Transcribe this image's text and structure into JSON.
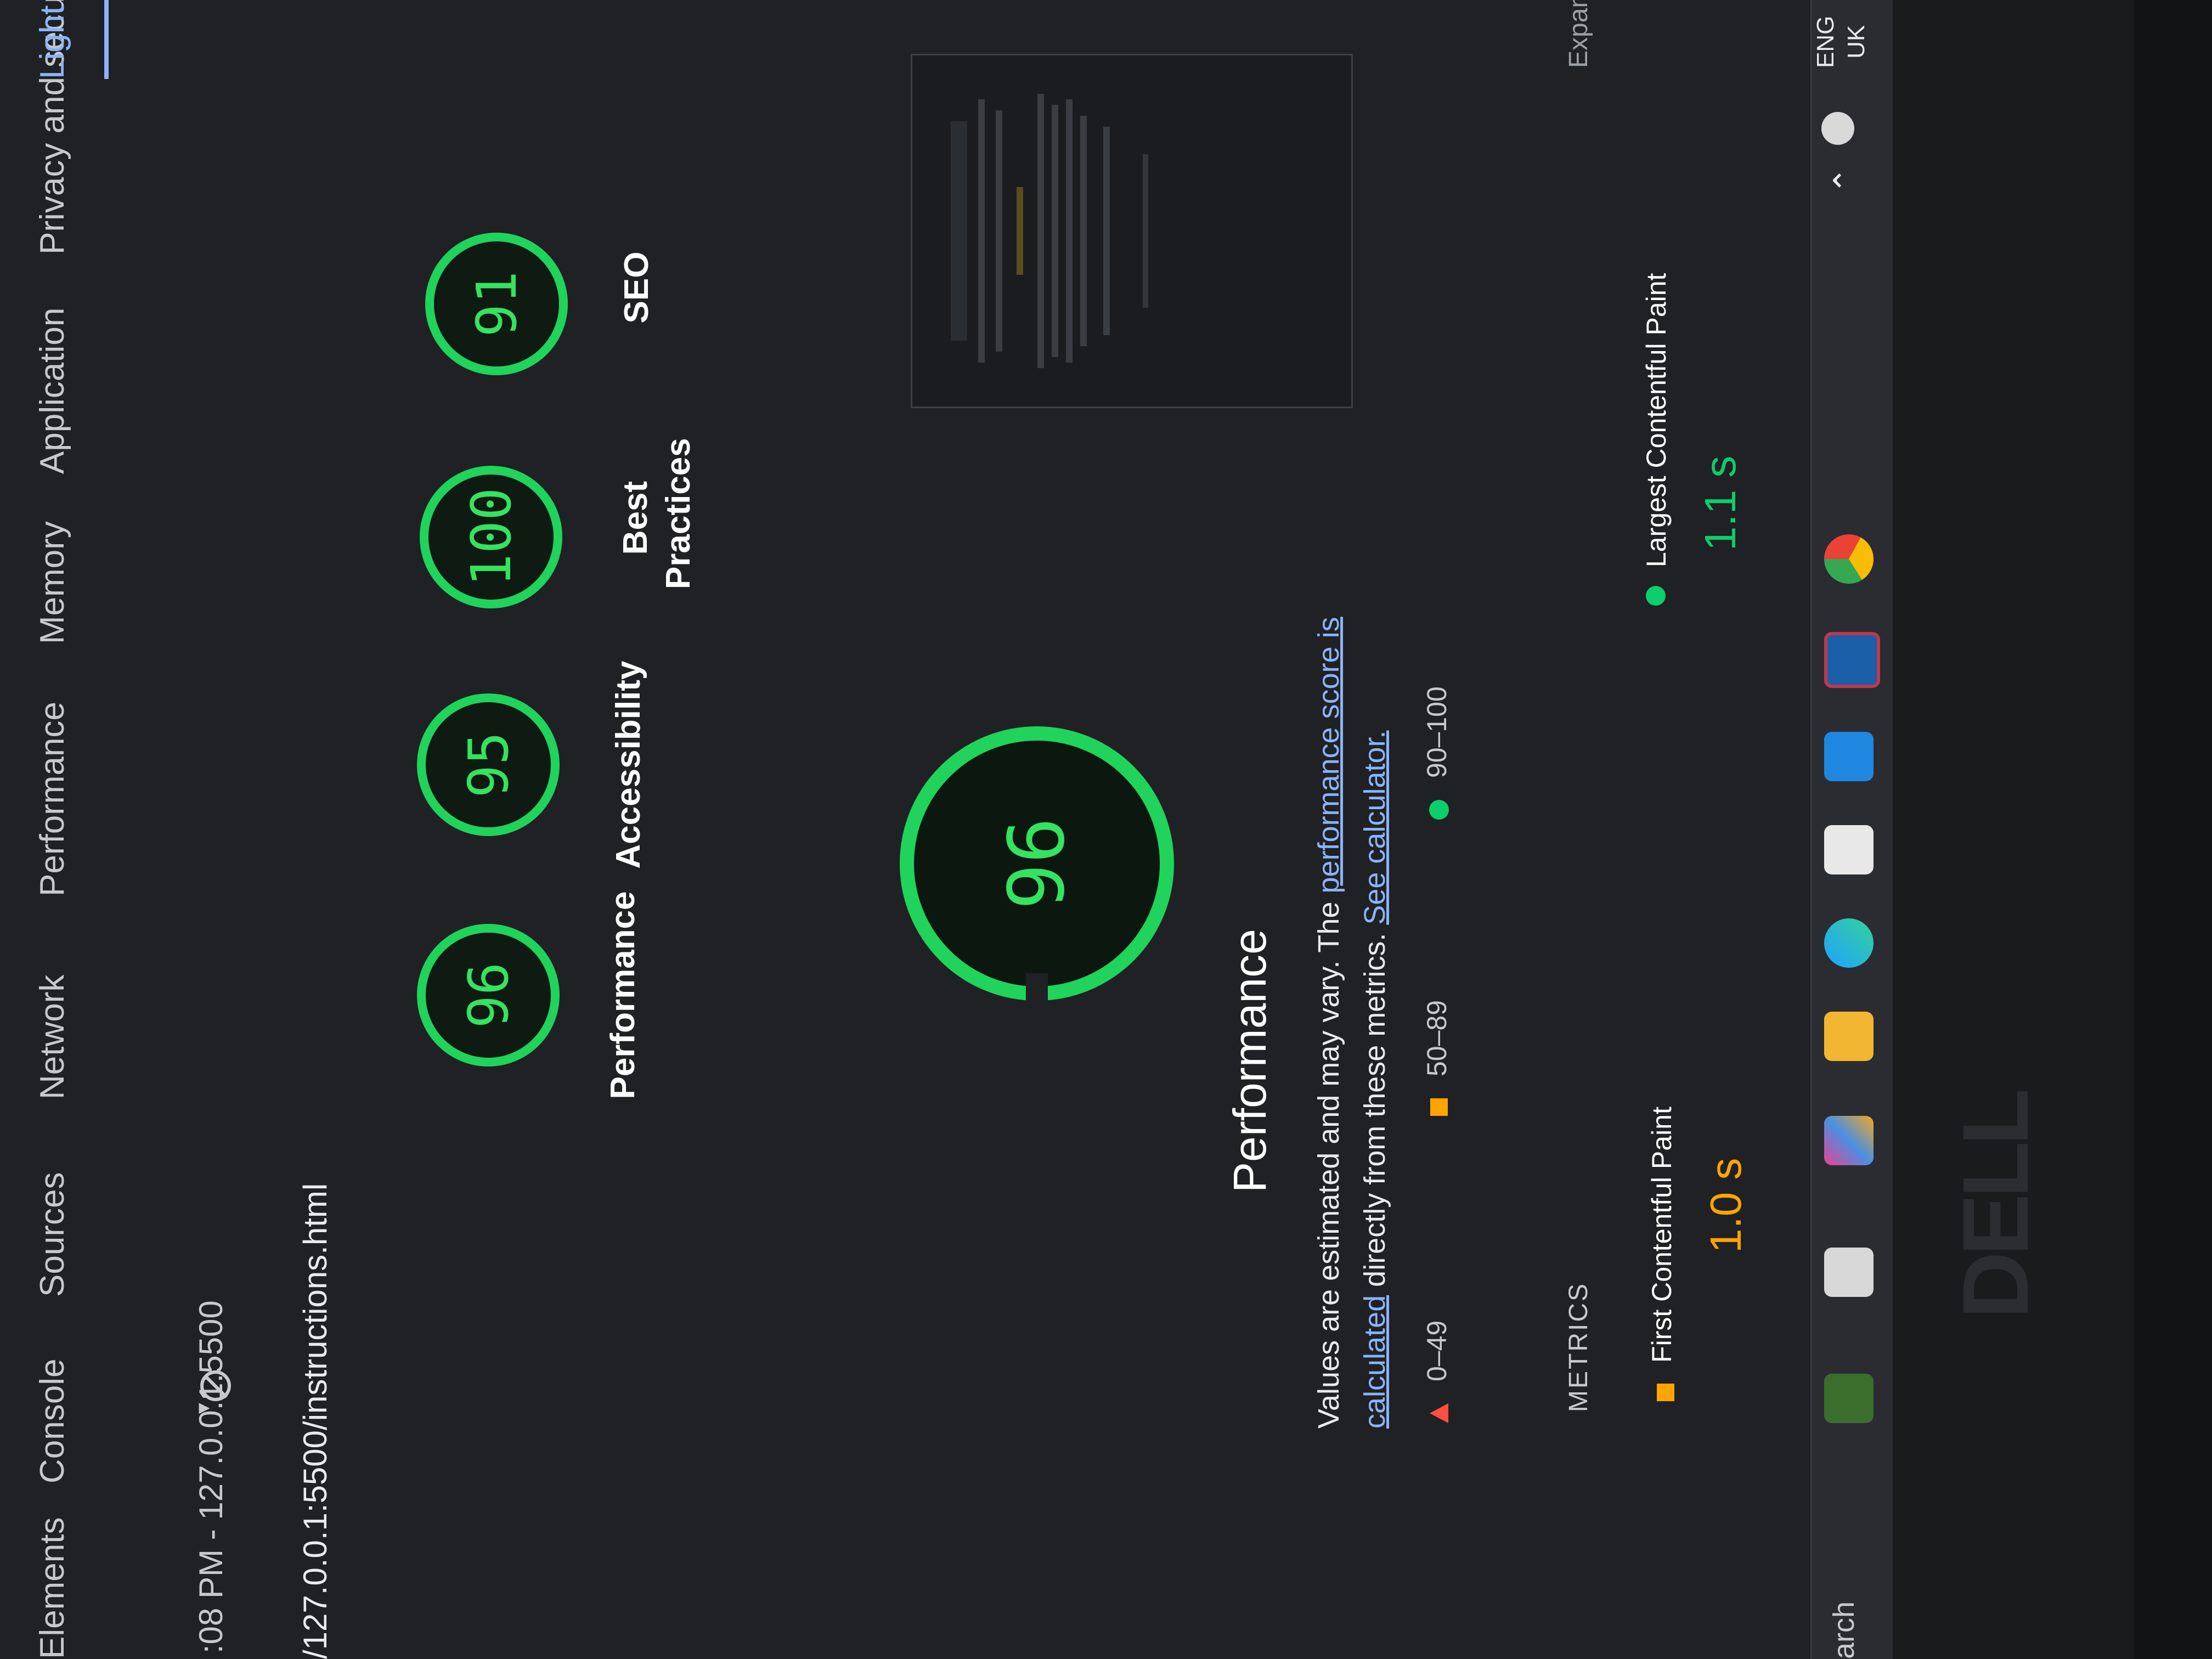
{
  "devtools": {
    "tabs": [
      "Elements",
      "Console",
      "Sources",
      "Network",
      "Performance",
      "Memory",
      "Application",
      "Privacy and security",
      "Light"
    ],
    "report_select": ":08 PM - 127.0.0.1:5500",
    "report_url": "/127.0.0.1:5500/instructions.html"
  },
  "scores": {
    "performance": {
      "value": "96",
      "label": "Performance"
    },
    "accessibility": {
      "value": "95",
      "label": "Accessibility"
    },
    "best_practices": {
      "value": "100",
      "label": "Best Practices"
    },
    "seo": {
      "value": "91",
      "label": "SEO"
    }
  },
  "main": {
    "score": "96",
    "title": "Performance",
    "desc_part1": "Values are estimated and may vary. The ",
    "desc_link1": "performance score is calculated",
    "desc_part2": " directly from these metrics. ",
    "desc_link2": "See calculator."
  },
  "legend": {
    "fail": "0–49",
    "average": "50–89",
    "pass": "90–100"
  },
  "metrics": {
    "heading": "METRICS",
    "expand": "Expand v",
    "fcp": {
      "label": "First Contentful Paint",
      "value": "1.0 s"
    },
    "lcp": {
      "label": "Largest Contentful Paint",
      "value": "1.1 s"
    }
  },
  "taskbar": {
    "search": "arch",
    "lang_line1": "ENG",
    "lang_line2": "UK"
  },
  "bezel": {
    "brand": "DELL"
  },
  "colors": {
    "pass": "#0cce6b",
    "average": "#ffa400",
    "fail": "#ff4e42",
    "link": "#8ab4f8"
  }
}
